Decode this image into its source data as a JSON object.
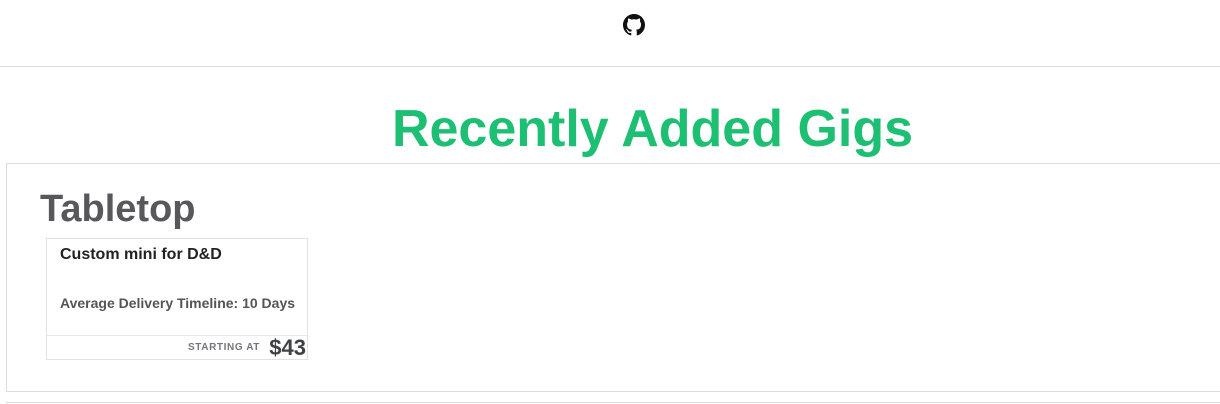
{
  "header": {
    "github_icon": "github-icon"
  },
  "main": {
    "heading": "Recently Added Gigs",
    "heading_color": "#1dbf73"
  },
  "categories": [
    {
      "title": "Tabletop",
      "gigs": [
        {
          "title": "Custom mini for D&D",
          "delivery_label": "Average Delivery Timeline:",
          "delivery_value": "10 Days",
          "starting_at_label": "STARTING AT",
          "price": "$43"
        }
      ]
    }
  ]
}
